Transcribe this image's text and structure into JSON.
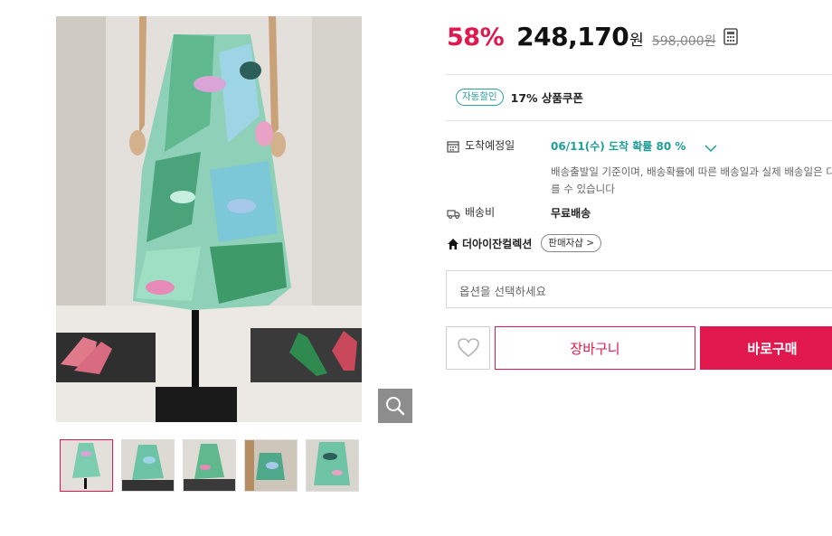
{
  "gallery": {
    "main_image_alt": "floral print pleated midi skirt on mannequin",
    "zoom_icon": "search-icon",
    "thumbnails": [
      {
        "id": "thumb-1",
        "active": true
      },
      {
        "id": "thumb-2",
        "active": false
      },
      {
        "id": "thumb-3",
        "active": false
      },
      {
        "id": "thumb-4",
        "active": false
      },
      {
        "id": "thumb-5",
        "active": false
      }
    ]
  },
  "price": {
    "discount": "58%",
    "sale_price": "248,170",
    "currency": "원",
    "original_price": "598,000원",
    "calculator_icon": "calculator-icon"
  },
  "coupon": {
    "badge": "자동할인",
    "text": "17% 상품쿠폰"
  },
  "delivery": {
    "arrival_label": "도착예정일",
    "arrival_value": "06/11(수) 도착 확률 80 %",
    "arrival_icon": "calendar-icon",
    "note": "배송출발일 기준이며, 배송확률에 따른 배송일과 실제 배송일은 다를 수 있습니다",
    "shipping_label": "배송비",
    "shipping_value": "무료배송",
    "shipping_icon": "truck-icon"
  },
  "seller": {
    "icon": "home-icon",
    "name": "더아이잔컬렉션",
    "button": "판매자샵 >"
  },
  "option": {
    "placeholder": "옵션을 선택하세요"
  },
  "actions": {
    "wish_icon": "heart-icon",
    "cart": "장바구니",
    "buy": "바로구매"
  },
  "colors": {
    "accent": "#e0184d",
    "teal": "#1f9e97"
  }
}
